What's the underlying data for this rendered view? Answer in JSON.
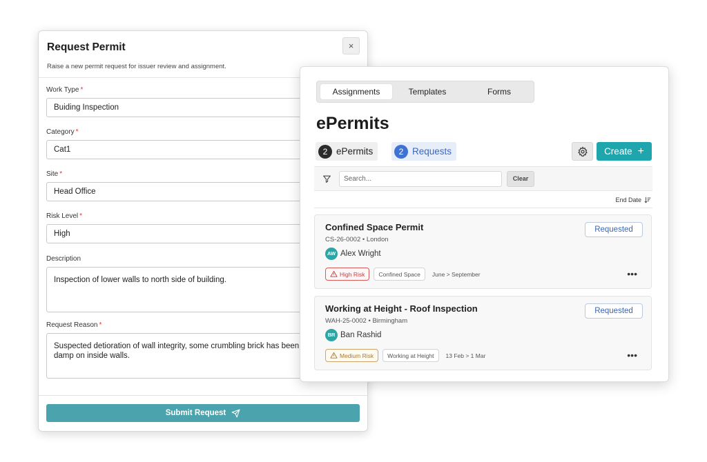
{
  "modal": {
    "title": "Request Permit",
    "subtitle": "Raise a new permit request for issuer review and assignment.",
    "close_glyph": "×",
    "fields": [
      {
        "label": "Work Type",
        "value": "Buiding Inspection",
        "required": "*"
      },
      {
        "label": "Category",
        "value": "Cat1",
        "required": "*"
      },
      {
        "label": "Site",
        "value": "Head Office",
        "required": "*"
      },
      {
        "label": "Risk Level",
        "value": "High",
        "required": "*"
      },
      {
        "label": "Description",
        "value": "Inspection of lower walls to north side of building."
      },
      {
        "label": "Request Reason",
        "value": "Suspected detioration of wall integrity, some crumbling brick has been found along with damp on inside walls.",
        "required": "*"
      }
    ],
    "submit_label": "Submit Request"
  },
  "panel": {
    "tabs": [
      {
        "label": "Assignments",
        "active": true
      },
      {
        "label": "Templates"
      },
      {
        "label": "Forms"
      }
    ],
    "title": "ePermits",
    "chips": [
      {
        "count": "2",
        "label": "ePermits"
      },
      {
        "count": "2",
        "label": "Requests"
      }
    ],
    "create_label": "Create",
    "create_glyph": "+",
    "search_placeholder": "Search...",
    "clear_label": "Clear",
    "sort_label": "End Date",
    "cards": [
      {
        "title": "Confined Space Permit",
        "sub": "CS-26-0002 • London",
        "initials": "AW",
        "assignee": "Alex Wright",
        "status": "Requested",
        "risk": "High Risk",
        "category": "Confined Space",
        "dates": "June > September"
      },
      {
        "title": "Working at Height - Roof Inspection",
        "sub": "WAH-25-0002 • Birmingham",
        "initials": "BR",
        "assignee": "Ban Rashid",
        "status": "Requested",
        "risk": "Medium Risk",
        "category": "Working at Height",
        "dates": "13 Feb > 1 Mar"
      }
    ],
    "more_glyph": "•••"
  },
  "colors": {
    "accent_teal": "#1fa6ad",
    "submit_teal": "#4aa3ad",
    "requests_blue": "#3f72d3",
    "high_risk": "#c93a3a",
    "medium_risk": "#a8782b",
    "avatar": "#2ea5a5"
  },
  "icons": [
    "close-icon",
    "send-icon",
    "gear-icon",
    "plus-icon",
    "filter-icon",
    "sort-descending-icon",
    "warning-triangle-icon",
    "more-horizontal-icon"
  ]
}
